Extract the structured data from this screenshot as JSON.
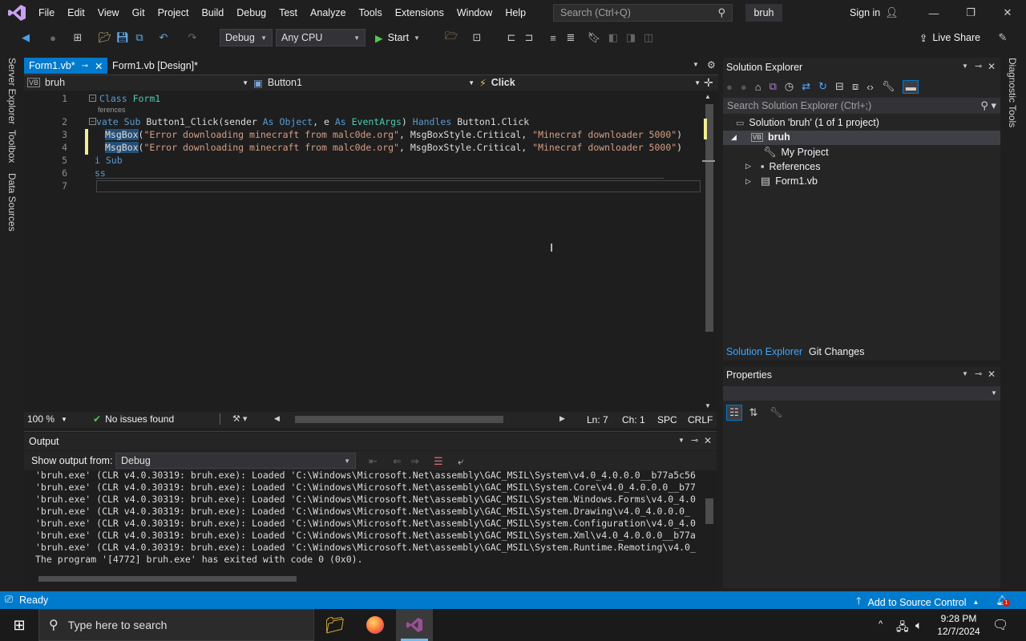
{
  "menubar": {
    "items": [
      "File",
      "Edit",
      "View",
      "Git",
      "Project",
      "Build",
      "Debug",
      "Test",
      "Analyze",
      "Tools",
      "Extensions",
      "Window",
      "Help"
    ],
    "search_placeholder": "Search (Ctrl+Q)",
    "solution_name": "bruh",
    "sign_in": "Sign in"
  },
  "toolbar": {
    "config": "Debug",
    "platform": "Any CPU",
    "start": "Start",
    "live_share": "Live Share"
  },
  "left_rail": [
    "Server Explorer",
    "Toolbox",
    "Data Sources"
  ],
  "right_rail": [
    "Diagnostic Tools"
  ],
  "tabs": [
    {
      "label": "Form1.vb*",
      "active": true
    },
    {
      "label": "Form1.vb [Design]*",
      "active": false
    }
  ],
  "navbar": {
    "project": "bruh",
    "object": "Button1",
    "event": "Click"
  },
  "editor": {
    "line_numbers": [
      "1",
      "2",
      "3",
      "4",
      "5",
      "6",
      "7"
    ],
    "codelens": "ferences",
    "lines": {
      "l1_kw": "Class",
      "l1_name": "Form1",
      "l2_kw1": "vate Sub",
      "l2_name": "Button1_Click(sender",
      "l2_as1": "As",
      "l2_t1": "Object",
      "l2_e": ", e",
      "l2_as2": "As",
      "l2_t2": "EventArgs",
      "l2_handles": "Handles",
      "l2_tail": "Button1.Click",
      "l3_fn": "MsgBox",
      "l3_str1": "\"Error downloading minecraft from malc0de.org\"",
      "l3_mid": ", MsgBoxStyle.Critical, ",
      "l3_str2": "\"Minecraf downloader 5000\"",
      "l5": "i Sub",
      "l6": "ss"
    }
  },
  "editor_status": {
    "zoom": "100 %",
    "issues": "No issues found",
    "line": "Ln: 7",
    "col": "Ch: 1",
    "spacing": "SPC",
    "eol": "CRLF"
  },
  "output": {
    "title": "Output",
    "show_from_label": "Show output from:",
    "source": "Debug",
    "lines": [
      "'bruh.exe' (CLR v4.0.30319: bruh.exe): Loaded 'C:\\Windows\\Microsoft.Net\\assembly\\GAC_MSIL\\System\\v4.0_4.0.0.0__b77a5c56",
      "'bruh.exe' (CLR v4.0.30319: bruh.exe): Loaded 'C:\\Windows\\Microsoft.Net\\assembly\\GAC_MSIL\\System.Core\\v4.0_4.0.0.0__b77",
      "'bruh.exe' (CLR v4.0.30319: bruh.exe): Loaded 'C:\\Windows\\Microsoft.Net\\assembly\\GAC_MSIL\\System.Windows.Forms\\v4.0_4.0",
      "'bruh.exe' (CLR v4.0.30319: bruh.exe): Loaded 'C:\\Windows\\Microsoft.Net\\assembly\\GAC_MSIL\\System.Drawing\\v4.0_4.0.0.0_",
      "'bruh.exe' (CLR v4.0.30319: bruh.exe): Loaded 'C:\\Windows\\Microsoft.Net\\assembly\\GAC_MSIL\\System.Configuration\\v4.0_4.0",
      "'bruh.exe' (CLR v4.0.30319: bruh.exe): Loaded 'C:\\Windows\\Microsoft.Net\\assembly\\GAC_MSIL\\System.Xml\\v4.0_4.0.0.0__b77a",
      "'bruh.exe' (CLR v4.0.30319: bruh.exe): Loaded 'C:\\Windows\\Microsoft.Net\\assembly\\GAC_MSIL\\System.Runtime.Remoting\\v4.0_",
      "The program '[4772] bruh.exe' has exited with code 0 (0x0)."
    ]
  },
  "solution_explorer": {
    "title": "Solution Explorer",
    "search_placeholder": "Search Solution Explorer (Ctrl+;)",
    "solution": "Solution 'bruh' (1 of 1 project)",
    "project": "bruh",
    "items": [
      "My Project",
      "References",
      "Form1.vb"
    ],
    "tab_active": "Solution Explorer",
    "tab_other": "Git Changes"
  },
  "properties": {
    "title": "Properties"
  },
  "statusbar": {
    "ready": "Ready",
    "source_control": "Add to Source Control"
  },
  "taskbar": {
    "search": "Type here to search",
    "time": "9:28 PM",
    "date": "12/7/2024"
  },
  "colors": {
    "accent": "#007acc",
    "vs_purple": "#9b4f96",
    "keyword": "#569cd6",
    "string": "#d69d85",
    "type": "#4ec9b0"
  }
}
